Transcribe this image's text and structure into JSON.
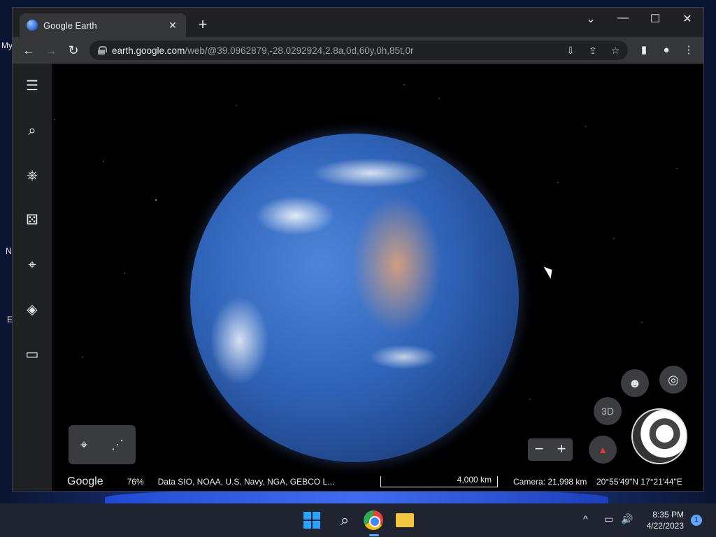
{
  "desktop": {
    "icon_labels": [
      "My",
      "N",
      "E"
    ]
  },
  "browser": {
    "tab": {
      "title": "Google Earth"
    },
    "address_bar": {
      "host": "earth.google.com",
      "path": "/web/@39.0962879,-28.0292924,2.8a,0d,60y,0h,85t,0r"
    },
    "icons": {
      "back": "←",
      "forward": "→",
      "reload": "↻",
      "new_tab": "+",
      "tab_close": "✕",
      "minimize": "—",
      "maximize": "☐",
      "close": "✕",
      "tab_search": "⌄",
      "install": "⇩",
      "share": "⇪",
      "bookmark": "☆",
      "sidepanel": "▮",
      "profile": "●",
      "menu": "⋮"
    }
  },
  "earth": {
    "sidebar_icons": [
      "☰",
      "⌕",
      "⎈",
      "⚄",
      "⌖",
      "◈",
      "▭"
    ],
    "place_panel_icons": [
      "⌖",
      "⋰"
    ],
    "controls": {
      "pegman": "☻",
      "locate": "◎",
      "mode_3d": "3D",
      "zoom_out": "−",
      "zoom_in": "+",
      "compass": "▲"
    },
    "status": {
      "logo": "Google",
      "progress": "76%",
      "attribution": "Data SIO, NOAA, U.S. Navy, NGA, GEBCO  L...",
      "scale": "4,000 km",
      "camera": "Camera: 21,998 km",
      "coordinates": "20°55'49\"N 17°21'44\"E"
    }
  },
  "taskbar": {
    "search_icon": "⌕",
    "tray": {
      "chevron": "^",
      "network": "▭",
      "volume": "🔊"
    },
    "clock_time": "8:35 PM",
    "clock_date": "4/22/2023",
    "notification_count": "1"
  },
  "colors": {
    "window_bg": "#202124",
    "toolbar_bg": "#35363a",
    "taskbar_bg": "#1f2430",
    "accent": "#5ea7ff"
  }
}
